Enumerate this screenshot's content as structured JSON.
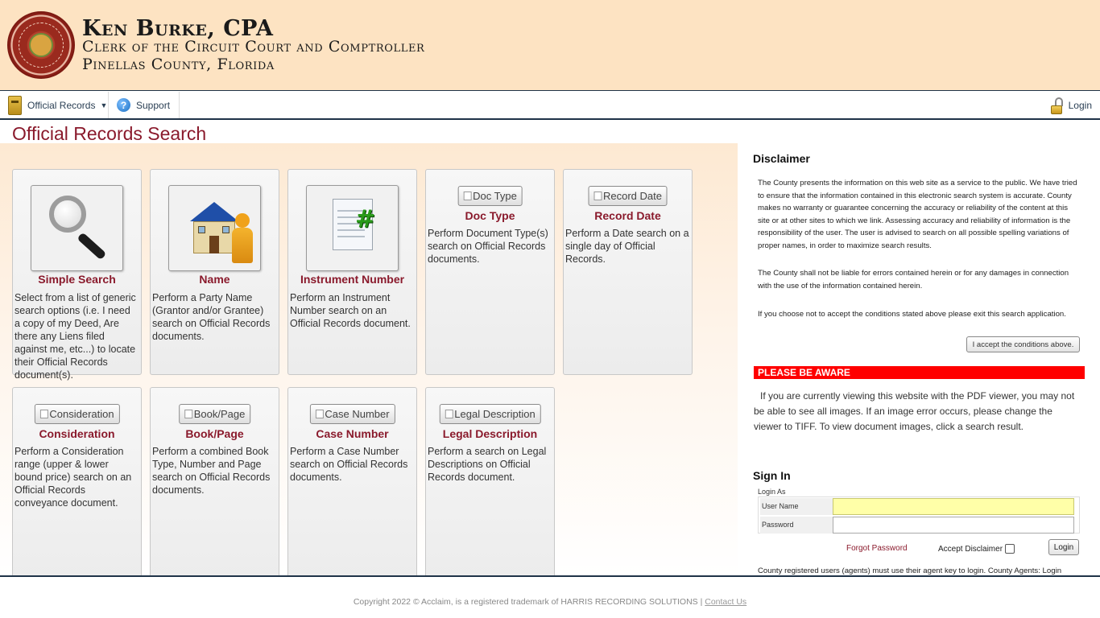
{
  "header": {
    "title": "Ken Burke, CPA",
    "subtitle1": "Clerk of the Circuit Court and Comptroller",
    "subtitle2": "Pinellas County, Florida",
    "seal_icon": "county-seal"
  },
  "nav": {
    "records_label": "Official Records",
    "support_label": "Support",
    "login_label": "Login"
  },
  "page_title": "Official Records Search",
  "cards": [
    {
      "title": "Simple Search",
      "desc": "Select from a list of generic search options (i.e. I need a copy of my Deed, Are there any Liens filed against me, etc...) to locate their Official Records document(s).",
      "icon": "magnifier-icon"
    },
    {
      "title": "Name",
      "desc": "Perform a Party Name (Grantor and/or Grantee) search on Official Records documents.",
      "icon": "house-person-icon"
    },
    {
      "title": "Instrument Number",
      "desc": "Perform an Instrument Number search on an Official Records document.",
      "icon": "document-hash-icon"
    },
    {
      "title": "Doc Type",
      "alt": "Doc Type",
      "desc": "Perform Document Type(s) search on Official Records documents."
    },
    {
      "title": "Record Date",
      "alt": "Record Date",
      "desc": "Perform a Date search on a single day of Official Records."
    },
    {
      "title": "Consideration",
      "alt": "Consideration",
      "desc": "Perform a Consideration range (upper & lower bound price) search on an Official Records conveyance document."
    },
    {
      "title": "Book/Page",
      "alt": "Book/Page",
      "desc": "Perform a combined Book Type, Number and Page search on Official Records documents."
    },
    {
      "title": "Case Number",
      "alt": "Case Number",
      "desc": "Perform a Case Number search on Official Records documents."
    },
    {
      "title": "Legal Description",
      "alt": "Legal Description",
      "desc": "Perform a search on Legal Descriptions on Official Records document."
    }
  ],
  "disclaimer": {
    "heading": "Disclaimer",
    "p1": "The County presents the information on this web site as a service to the public. We have tried to ensure that the information contained in this electronic search system is accurate. County makes no warranty or guarantee concerning the accuracy or reliability of the content at this site or at other sites to which we link. Assessing accuracy and reliability of information is the responsibility of the user. The user is advised to search on all possible spelling variations of proper names, in order to maximize search results.",
    "p2": "The County shall not be liable for errors contained herein or for any damages in connection with the use of the information contained herein.",
    "p3": "If you choose not to accept the conditions stated above please exit this search application.",
    "accept_button": "I accept the conditions above."
  },
  "aware": {
    "banner": "PLEASE BE AWARE",
    "text": "If you are currently viewing this website with the PDF viewer, you may not be able to see all images. If an image error occurs, please change the viewer to TIFF. To view document images, click a search result."
  },
  "signin": {
    "heading": "Sign In",
    "login_as": "Login As",
    "username_label": "User Name",
    "password_label": "Password",
    "forgot": "Forgot Password",
    "accept_disclaimer": "Accept Disclaimer",
    "login_button": "Login",
    "agents_note": "County registered users (agents) must use their agent key to login. County Agents: Login"
  },
  "footer": {
    "copyright": "Copyright 2022 © Acclaim, is a registered trademark of HARRIS RECORDING SOLUTIONS | ",
    "contact": "Contact Us"
  },
  "colors": {
    "header_bg": "#fde3c2",
    "title_red": "#8a1a2c",
    "banner_red": "#ff0000",
    "nav_dark": "#1f3348"
  }
}
